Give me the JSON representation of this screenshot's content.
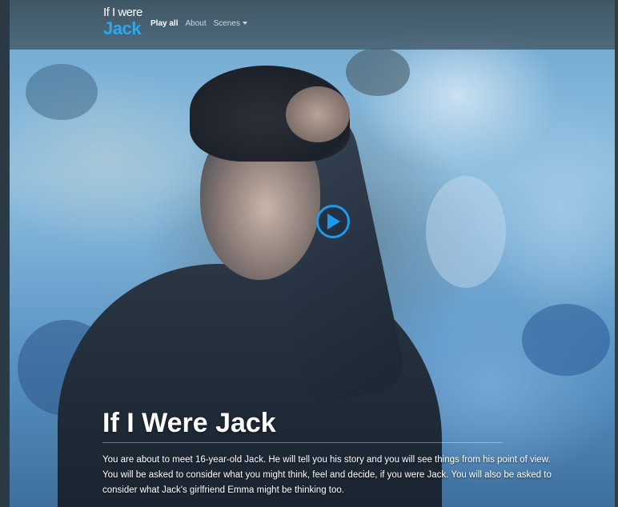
{
  "brand": {
    "logo_line1": "If I were",
    "logo_line2": "Jack",
    "accent_color": "#2fa7ee"
  },
  "nav": {
    "items": [
      {
        "label": "Play all",
        "active": true
      },
      {
        "label": "About",
        "active": false
      },
      {
        "label": "Scenes",
        "active": false,
        "dropdown": true
      }
    ]
  },
  "hero": {
    "play_icon": "play-icon",
    "title": "If I Were Jack",
    "description": "You are about to meet 16-year-old Jack. He will tell you his story and you will see things from his point of view. You will be asked to consider what you might think, feel and decide, if you were Jack. You will also be asked to consider what Jack's girlfriend Emma might be thinking too."
  }
}
